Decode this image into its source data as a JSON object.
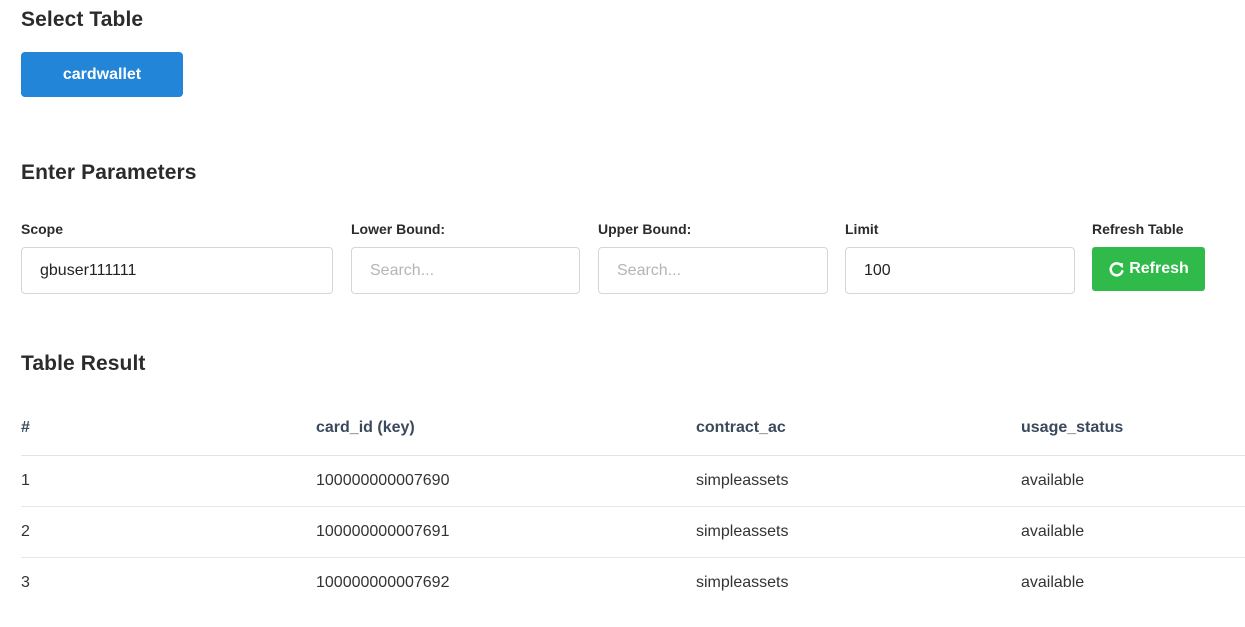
{
  "select_table": {
    "title": "Select Table",
    "table_button_label": "cardwallet"
  },
  "parameters": {
    "title": "Enter Parameters",
    "scope": {
      "label": "Scope",
      "value": "gbuser111111",
      "placeholder": ""
    },
    "lower_bound": {
      "label": "Lower Bound:",
      "value": "",
      "placeholder": "Search..."
    },
    "upper_bound": {
      "label": "Upper Bound:",
      "value": "",
      "placeholder": "Search..."
    },
    "limit": {
      "label": "Limit",
      "value": "100",
      "placeholder": ""
    },
    "refresh": {
      "label": "Refresh Table",
      "button_label": "Refresh",
      "icon": "refresh-icon"
    }
  },
  "results": {
    "title": "Table Result",
    "columns": [
      "#",
      "card_id (key)",
      "contract_ac",
      "usage_status"
    ],
    "rows": [
      [
        "1",
        "100000000007690",
        "simpleassets",
        "available"
      ],
      [
        "2",
        "100000000007691",
        "simpleassets",
        "available"
      ],
      [
        "3",
        "100000000007692",
        "simpleassets",
        "available"
      ]
    ]
  },
  "colors": {
    "primary_button": "#2285d8",
    "refresh_button": "#2fba4a"
  }
}
